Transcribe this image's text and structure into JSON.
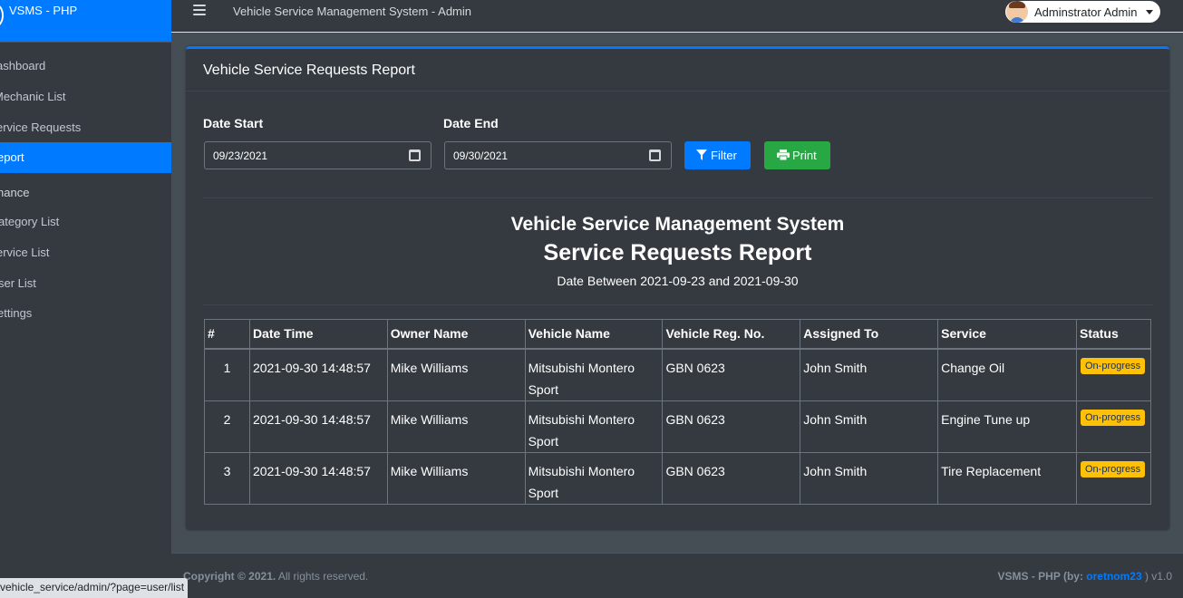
{
  "sidebar": {
    "brand": "VSMS - PHP",
    "items": [
      {
        "label": "ashboard"
      },
      {
        "label": "Mechanic List"
      },
      {
        "label": "ervice Requests"
      },
      {
        "label": "eport"
      }
    ],
    "header": "hance",
    "items2": [
      {
        "label": "ategory List"
      },
      {
        "label": "ervice List"
      },
      {
        "label": "ser List"
      },
      {
        "label": "ettings"
      }
    ]
  },
  "topbar": {
    "title": "Vehicle Service Management System - Admin",
    "user": "Adminstrator Admin"
  },
  "card": {
    "title": "Vehicle Service Requests Report",
    "date_start_label": "Date Start",
    "date_start_value": "09/23/2021",
    "date_end_label": "Date End",
    "date_end_value": "09/30/2021",
    "filter_label": "Filter",
    "print_label": "Print"
  },
  "report": {
    "title": "Vehicle Service Management System",
    "subtitle": "Service Requests Report",
    "range": "Date Between 2021-09-23 and 2021-09-30"
  },
  "table": {
    "headers": [
      "#",
      "Date Time",
      "Owner Name",
      "Vehicle Name",
      "Vehicle Reg. No.",
      "Assigned To",
      "Service",
      "Status"
    ],
    "rows": [
      {
        "num": "1",
        "datetime": "2021-09-30 14:48:57",
        "owner": "Mike Williams",
        "vehicle": "Mitsubishi Montero Sport",
        "reg": "GBN 0623",
        "assigned": "John Smith",
        "service": "Change Oil",
        "status": "On-progress"
      },
      {
        "num": "2",
        "datetime": "2021-09-30 14:48:57",
        "owner": "Mike Williams",
        "vehicle": "Mitsubishi Montero Sport",
        "reg": "GBN 0623",
        "assigned": "John Smith",
        "service": "Engine Tune up",
        "status": "On-progress"
      },
      {
        "num": "3",
        "datetime": "2021-09-30 14:48:57",
        "owner": "Mike Williams",
        "vehicle": "Mitsubishi Montero Sport",
        "reg": "GBN 0623",
        "assigned": "John Smith",
        "service": "Tire Replacement",
        "status": "On-progress"
      }
    ]
  },
  "footer": {
    "copyright_bold": "Copyright © 2021.",
    "copyright_rest": " All rights reserved.",
    "credit_prefix": "VSMS - PHP (by: ",
    "credit_author": "oretnom23",
    "credit_suffix": " ) v1.0"
  },
  "status_url": "vehicle_service/admin/?page=user/list",
  "colors": {
    "accent": "#007bff",
    "success": "#28a745",
    "warning": "#ffc107",
    "panel": "#343a40",
    "background": "#454d55"
  }
}
